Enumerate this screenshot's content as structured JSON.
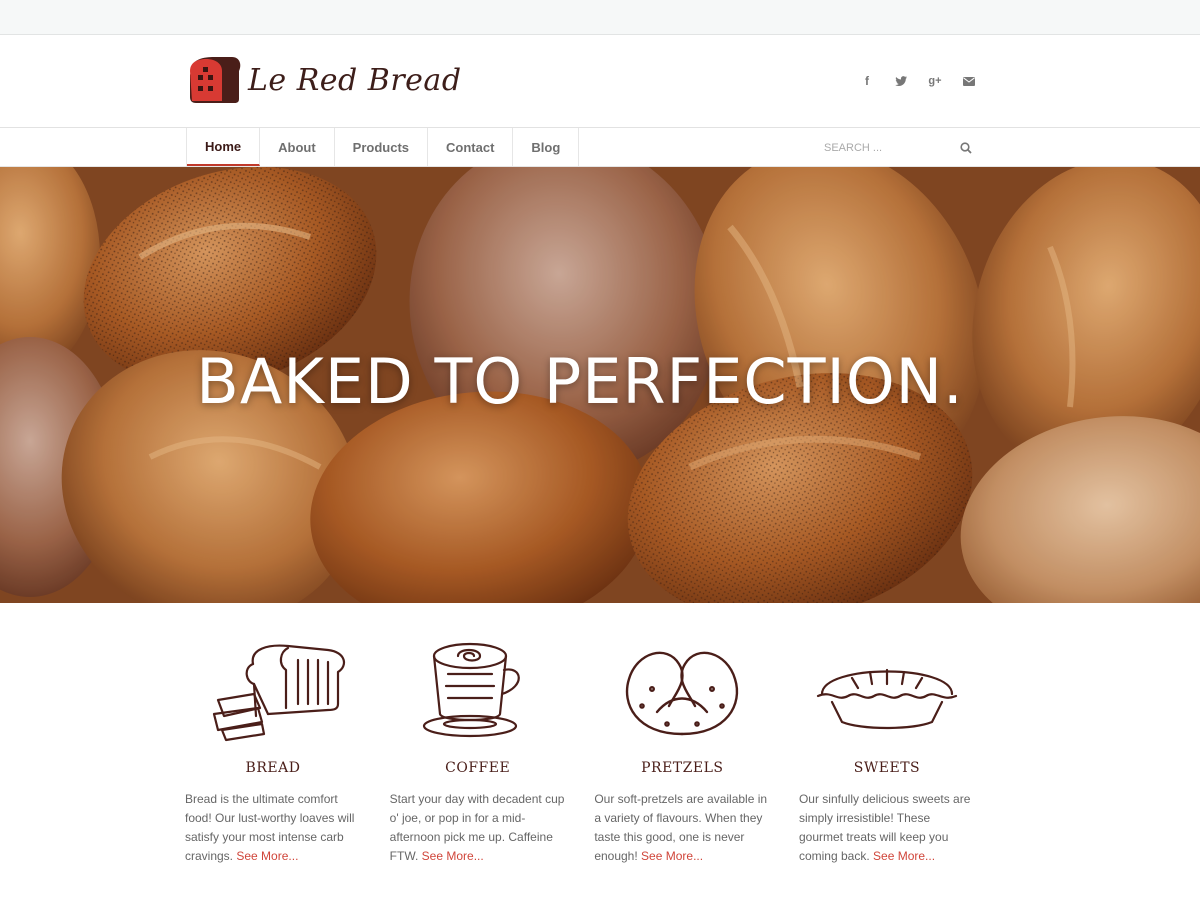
{
  "brand": {
    "name": "Le Red Bread",
    "accent": "#c0392b"
  },
  "social": [
    {
      "name": "facebook-icon",
      "glyph": "f"
    },
    {
      "name": "twitter-icon",
      "glyph": "🐦"
    },
    {
      "name": "google-plus-icon",
      "glyph": "g+"
    },
    {
      "name": "mail-icon",
      "glyph": "✉"
    }
  ],
  "nav": {
    "items": [
      "Home",
      "About",
      "Products",
      "Contact",
      "Blog"
    ],
    "active": "Home"
  },
  "search": {
    "placeholder": "SEARCH ..."
  },
  "hero": {
    "title": "BAKED TO PERFECTION."
  },
  "features": [
    {
      "title": "BREAD",
      "text": "Bread is the ultimate comfort food! Our lust-worthy loaves will satisfy your most intense carb cravings.",
      "link": "See More..."
    },
    {
      "title": "COFFEE",
      "text": "Start your day with decadent cup o' joe, or pop in for a mid-afternoon pick me up. Caffeine FTW.",
      "link": "See More..."
    },
    {
      "title": "PRETZELS",
      "text": "Our soft-pretzels are available in a variety of flavours. When they taste this good, one is never enough!",
      "link": "See More..."
    },
    {
      "title": "SWEETS",
      "text": "Our sinfully delicious sweets are simply irresistible! These gourmet treats will keep you coming back.",
      "link": "See More..."
    }
  ]
}
